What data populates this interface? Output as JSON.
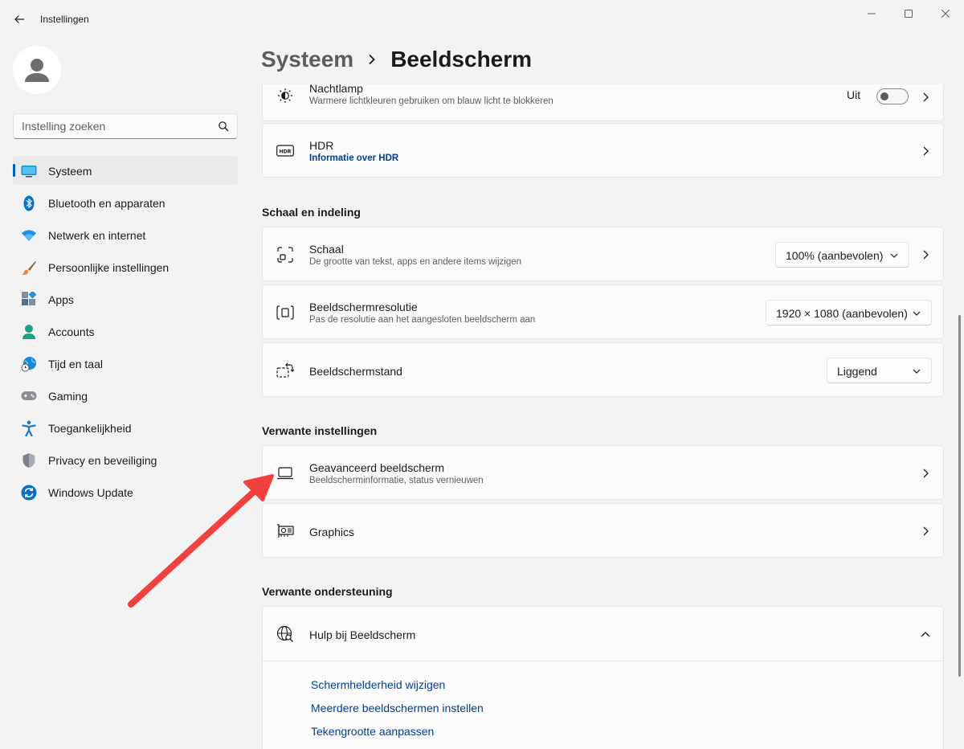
{
  "window": {
    "app_title": "Instellingen"
  },
  "search": {
    "placeholder": "Instelling zoeken"
  },
  "sidebar": {
    "items": [
      {
        "label": "Systeem",
        "icon": "system-icon",
        "active": true
      },
      {
        "label": "Bluetooth en apparaten",
        "icon": "bluetooth-icon"
      },
      {
        "label": "Netwerk en internet",
        "icon": "wifi-icon"
      },
      {
        "label": "Persoonlijke instellingen",
        "icon": "brush-icon"
      },
      {
        "label": "Apps",
        "icon": "apps-icon"
      },
      {
        "label": "Accounts",
        "icon": "account-icon"
      },
      {
        "label": "Tijd en taal",
        "icon": "globe-clock-icon"
      },
      {
        "label": "Gaming",
        "icon": "gamepad-icon"
      },
      {
        "label": "Toegankelijkheid",
        "icon": "accessibility-icon"
      },
      {
        "label": "Privacy en beveiliging",
        "icon": "shield-icon"
      },
      {
        "label": "Windows Update",
        "icon": "update-icon"
      }
    ]
  },
  "header": {
    "parent": "Systeem",
    "current": "Beeldscherm"
  },
  "nightlight": {
    "title": "Nachtlamp",
    "subtitle": "Warmere lichtkleuren gebruiken om blauw licht te blokkeren",
    "state": "Uit",
    "on": false
  },
  "hdr": {
    "title": "HDR",
    "link": "Informatie over HDR"
  },
  "scale_section": {
    "title": "Schaal en indeling",
    "scale": {
      "title": "Schaal",
      "subtitle": "De grootte van tekst, apps en andere items wijzigen",
      "value": "100% (aanbevolen)"
    },
    "resolution": {
      "title": "Beeldschermresolutie",
      "subtitle": "Pas de resolutie aan het aangesloten beeldscherm aan",
      "value": "1920 × 1080 (aanbevolen)"
    },
    "orientation": {
      "title": "Beeldschermstand",
      "value": "Liggend"
    }
  },
  "related_settings": {
    "title": "Verwante instellingen",
    "advanced": {
      "title": "Geavanceerd beeldscherm",
      "subtitle": "Beeldscherminformatie, status vernieuwen"
    },
    "graphics": {
      "title": "Graphics"
    }
  },
  "related_support": {
    "title": "Verwante ondersteuning",
    "help": {
      "title": "Hulp bij Beeldscherm",
      "links": [
        "Schermhelderheid wijzigen",
        "Meerdere beeldschermen instellen",
        "Tekengrootte aanpassen"
      ]
    }
  },
  "colors": {
    "accent": "#005fb8",
    "link": "#003e92",
    "annotation_arrow": "#f04040"
  }
}
